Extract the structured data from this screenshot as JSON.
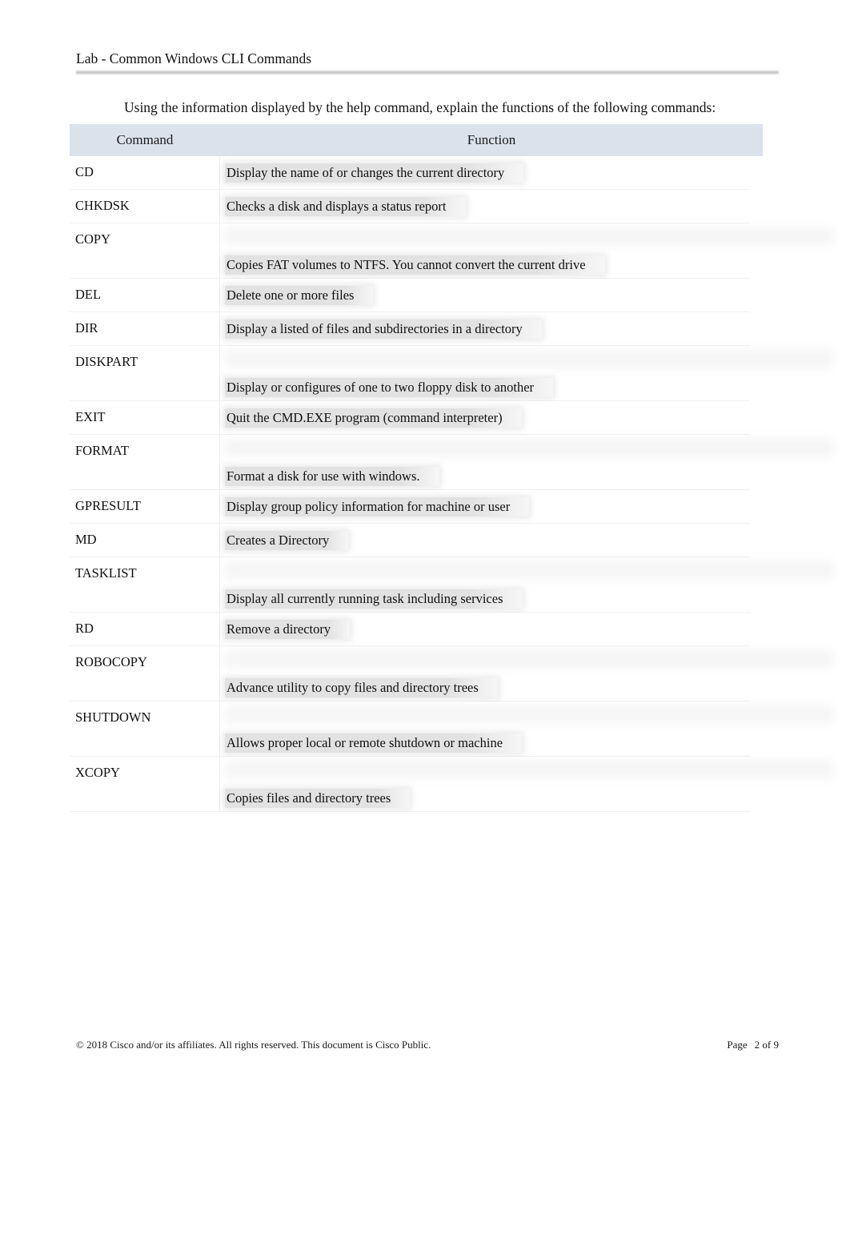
{
  "document": {
    "running_header": "Lab - Common Windows CLI Commands",
    "intro": "Using the information displayed by the help command, explain the functions of the following commands:"
  },
  "table": {
    "headers": {
      "command": "Command",
      "function": "Function"
    },
    "header_bg": "#dbe2ec",
    "rows": [
      {
        "command": "CD",
        "function": "Display the name of or changes the current directory",
        "layout": "top"
      },
      {
        "command": "CHKDSK",
        "function": "Checks a disk and displays a status report",
        "layout": "top"
      },
      {
        "command": "COPY",
        "function": "Copies FAT volumes to NTFS. You cannot convert the current drive",
        "layout": "split"
      },
      {
        "command": "DEL",
        "function": "Delete one or more files",
        "layout": "top"
      },
      {
        "command": "DIR",
        "function": "Display a listed of files and subdirectories in a directory",
        "layout": "top"
      },
      {
        "command": "DISKPART",
        "function": "Display or configures of one to two floppy disk to another",
        "layout": "split"
      },
      {
        "command": "EXIT",
        "function": "Quit the CMD.EXE program (command interpreter)",
        "layout": "top"
      },
      {
        "command": "FORMAT",
        "function": "Format a disk for use with windows.",
        "layout": "split"
      },
      {
        "command": "GPRESULT",
        "function": "Display group policy information for machine or user",
        "layout": "top"
      },
      {
        "command": "MD",
        "function": "Creates a Directory",
        "layout": "top"
      },
      {
        "command": "TASKLIST",
        "function": "Display all currently running task including services",
        "layout": "split"
      },
      {
        "command": "RD",
        "function": "Remove a directory",
        "layout": "top"
      },
      {
        "command": "ROBOCOPY",
        "function": "Advance utility to copy files and directory trees",
        "layout": "split"
      },
      {
        "command": "SHUTDOWN",
        "function": "Allows proper local or remote shutdown or machine",
        "layout": "split"
      },
      {
        "command": "XCOPY",
        "function": "Copies files and directory trees",
        "layout": "split"
      }
    ]
  },
  "footer": {
    "copyright": "© 2018 Cisco and/or its affiliates. All rights reserved. This document is Cisco Public.",
    "page_label": "Page",
    "page_value": "2 of 9"
  }
}
